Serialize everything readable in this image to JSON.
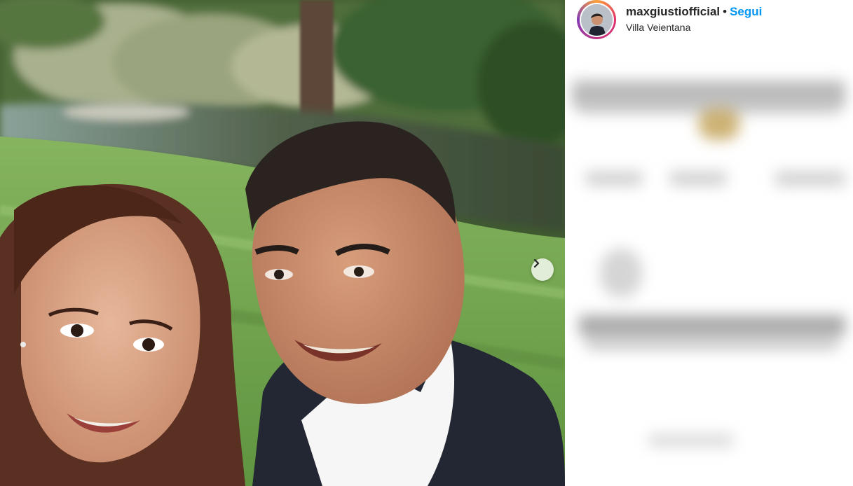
{
  "post": {
    "photo_alt": "Selfie",
    "next_icon": "chevron-right-icon"
  },
  "header": {
    "username": "maxgiustiofficial",
    "separator": "•",
    "follow_label": "Segui",
    "location": "Villa Veientana"
  },
  "colors": {
    "follow_blue": "#0095f6",
    "text": "#262626"
  }
}
